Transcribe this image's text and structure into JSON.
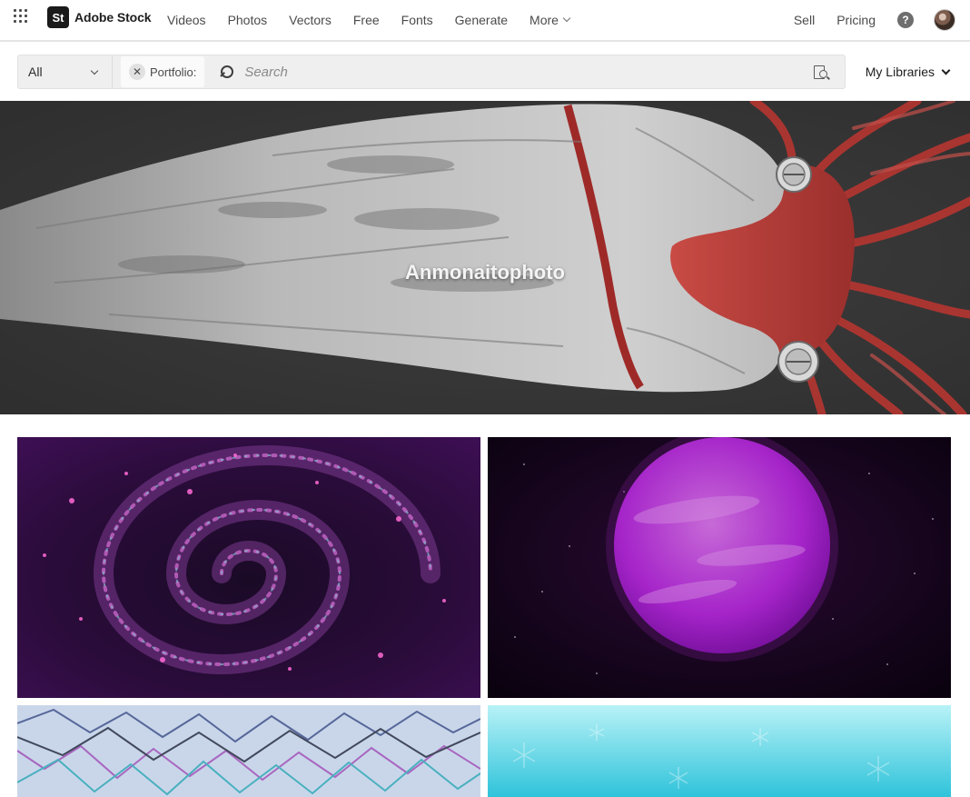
{
  "brand": {
    "logo_text": "St",
    "name": "Adobe Stock",
    "icon": "adobe-stock-logo"
  },
  "nav": {
    "apps_icon": "app-grid-icon",
    "links": [
      "Videos",
      "Photos",
      "Vectors",
      "Free",
      "Fonts",
      "Generate"
    ],
    "more_label": "More",
    "sell_label": "Sell",
    "pricing_label": "Pricing",
    "help_icon": "help-icon",
    "help_glyph": "?",
    "avatar_icon": "user-avatar"
  },
  "search": {
    "type_selected": "All",
    "portfolio_chip_label": "Portfolio:",
    "chip_close_glyph": "✕",
    "placeholder": "Search",
    "value": "",
    "visual_search_icon": "visual-search-icon",
    "my_libraries_label": "My Libraries"
  },
  "hero": {
    "title": "Anmonaitophoto"
  },
  "gallery": {
    "tiles": [
      {
        "subject": "purple spiral galaxy"
      },
      {
        "subject": "purple planet"
      },
      {
        "subject": "purple blue scribble texture"
      },
      {
        "subject": "cyan snowflake background"
      }
    ]
  },
  "colors": {
    "accent_dark": "#1a1a1a",
    "search_bg": "#efefef",
    "hero_bg": "#3a3a3a",
    "squid_red": "#b23a36"
  }
}
